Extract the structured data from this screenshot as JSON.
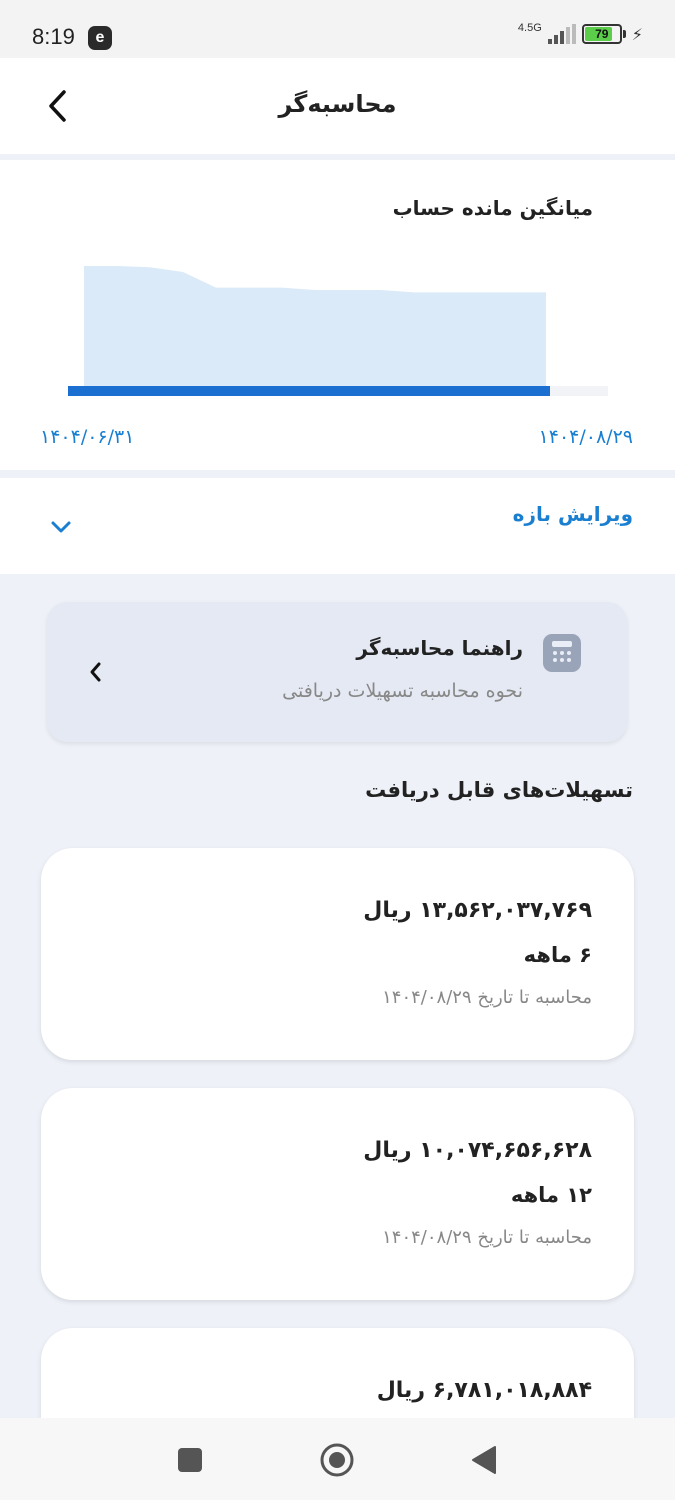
{
  "status_bar": {
    "time": "8:19",
    "app_icon_letter": "e",
    "network": "4.5G",
    "battery": "79",
    "battery_level": 0.79
  },
  "header": {
    "title": "محاسبه‌گر"
  },
  "chart": {
    "title": "میانگین مانده حساب",
    "start_date": "۱۴۰۴/۰۸/۲۹",
    "end_date": "۱۴۰۴/۰۶/۳۱",
    "fill_color": "#dbeaf8",
    "bar_color": "#1a6fd0"
  },
  "chart_data": {
    "type": "area",
    "x": [
      "۱۴۰۴/۰۸/۲۹",
      "۱۴۰۴/۰۶/۳۱"
    ],
    "series": [
      {
        "values": [
          0.78,
          0.78,
          0.78,
          0.78,
          0.78,
          0.8,
          0.8,
          0.8,
          0.82,
          0.82,
          0.82,
          0.95,
          0.99,
          1.0,
          1.0
        ]
      }
    ],
    "xlabel": "",
    "ylabel": ""
  },
  "range": {
    "label": "ویرایش بازه"
  },
  "guide": {
    "title": "راهنما محاسبه‌گر",
    "subtitle": "نحوه محاسبه تسهیلات دریافتی"
  },
  "section": {
    "title": "تسهیلات‌های قابل دریافت"
  },
  "loans": [
    {
      "amount": "۱۳,۵۶۲,۰۳۷,۷۶۹ ریال",
      "term": "۶ ماهه",
      "date": "محاسبه تا تاریخ ۱۴۰۴/۰۸/۲۹"
    },
    {
      "amount": "۱۰,۰۷۴,۶۵۶,۶۲۸ ریال",
      "term": "۱۲ ماهه",
      "date": "محاسبه تا تاریخ ۱۴۰۴/۰۸/۲۹"
    },
    {
      "amount": "۶,۷۸۱,۰۱۸,۸۸۴ ریال"
    }
  ]
}
